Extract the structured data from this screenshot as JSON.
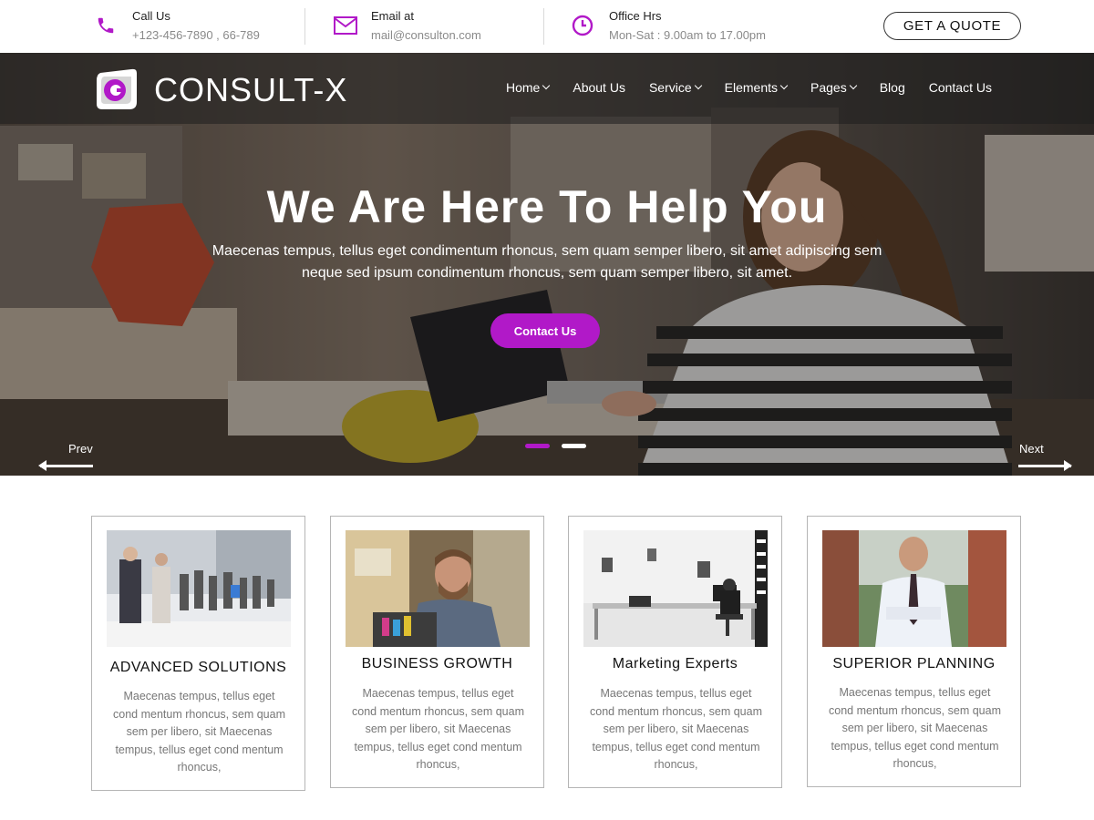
{
  "topbar": {
    "call": {
      "title": "Call Us",
      "value": "+123-456-7890 , 66-789",
      "icon": "phone-icon"
    },
    "email": {
      "title": "Email at",
      "value": "mail@consulton.com",
      "icon": "envelope-icon"
    },
    "hours": {
      "title": "Office Hrs",
      "value": "Mon-Sat : 9.00am to 17.00pm",
      "icon": "clock-icon"
    },
    "quote_button": "GET A QUOTE"
  },
  "brand": {
    "name": "CONSULT-X",
    "accent": "#b119c8"
  },
  "nav": {
    "items": [
      {
        "label": "Home",
        "dropdown": true
      },
      {
        "label": "About Us",
        "dropdown": false
      },
      {
        "label": "Service",
        "dropdown": true
      },
      {
        "label": "Elements",
        "dropdown": true
      },
      {
        "label": "Pages",
        "dropdown": true
      },
      {
        "label": "Blog",
        "dropdown": false
      },
      {
        "label": "Contact Us",
        "dropdown": false
      }
    ]
  },
  "hero": {
    "title": "We Are Here To Help You",
    "text": "Maecenas tempus, tellus eget condimentum rhoncus, sem quam semper libero, sit amet adipiscing sem neque sed ipsum condimentum rhoncus, sem quam semper libero, sit amet.",
    "button": "Contact Us",
    "prev": "Prev",
    "next": "Next",
    "slides": 2,
    "active_slide": 1
  },
  "cards": [
    {
      "title": "ADVANCED SOLUTIONS",
      "text": "Maecenas tempus, tellus eget cond mentum rhoncus, sem quam sem per libero, sit Maecenas tempus, tellus eget cond mentum rhoncus,"
    },
    {
      "title": "BUSINESS GROWTH",
      "text": "Maecenas tempus, tellus eget cond mentum rhoncus, sem quam sem per libero, sit Maecenas tempus, tellus eget cond mentum rhoncus,"
    },
    {
      "title": "Marketing Experts",
      "text": "Maecenas tempus, tellus eget cond mentum rhoncus, sem quam sem per libero, sit Maecenas tempus, tellus eget cond mentum rhoncus,"
    },
    {
      "title": "SUPERIOR PLANNING",
      "text": "Maecenas tempus, tellus eget cond mentum rhoncus, sem quam sem per libero, sit Maecenas tempus, tellus eget cond mentum rhoncus,"
    }
  ]
}
